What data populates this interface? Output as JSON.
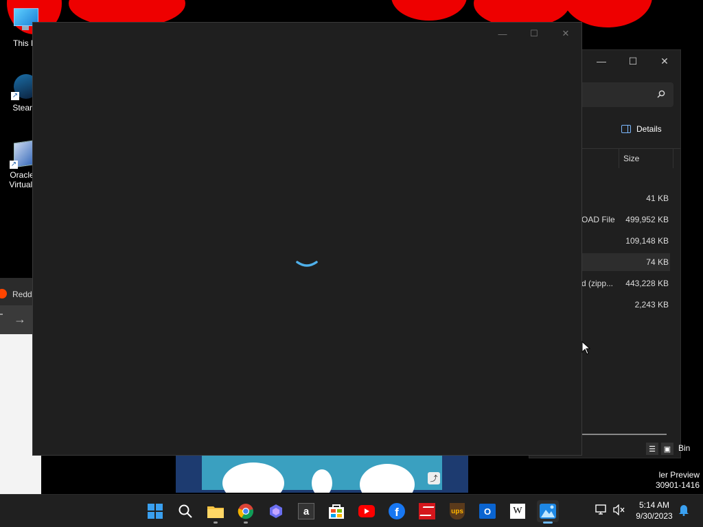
{
  "desktop": {
    "icons": [
      {
        "label": "This P",
        "icon": "monitor-icon"
      },
      {
        "label": "Stean",
        "icon": "steam-icon"
      },
      {
        "label": "Oracle",
        "label2": "VirtualI",
        "icon": "virtualbox-icon"
      }
    ],
    "watermark": {
      "line1": "ler Preview",
      "line2": "30901-1416"
    },
    "recycle_bin_label": "Bin"
  },
  "photos_window": {
    "controls": {
      "minimize": "—",
      "maximize": "☐",
      "close": "✕"
    },
    "state": "loading"
  },
  "explorer_window": {
    "controls": {
      "minimize": "—",
      "maximize": "☐",
      "close": "✕"
    },
    "search_icon": "search-icon",
    "details_label": "Details",
    "column_size": "Size",
    "rows": [
      {
        "type": "",
        "size": "41 KB"
      },
      {
        "type": "OAD File",
        "size": "499,952 KB"
      },
      {
        "type": "",
        "size": "109,148 KB"
      },
      {
        "type": "",
        "size": "74 KB",
        "selected": true
      },
      {
        "type": "d (zipp...",
        "size": "443,228 KB"
      },
      {
        "type": "",
        "size": "2,243 KB"
      }
    ]
  },
  "browser": {
    "tab_label": "Reddi",
    "forward_icon": "→"
  },
  "taskbar": {
    "apps": [
      {
        "name": "start",
        "icon": "windows-icon"
      },
      {
        "name": "search",
        "icon": "search-icon"
      },
      {
        "name": "file-explorer",
        "icon": "folder-icon",
        "running": true
      },
      {
        "name": "chrome",
        "icon": "chrome-icon",
        "running": true
      },
      {
        "name": "copilot",
        "icon": "copilot-icon"
      },
      {
        "name": "amazon",
        "icon": "amazon-icon"
      },
      {
        "name": "store",
        "icon": "store-icon"
      },
      {
        "name": "youtube",
        "icon": "youtube-icon"
      },
      {
        "name": "facebook",
        "icon": "facebook-icon"
      },
      {
        "name": "bank-of-america",
        "icon": "bank-icon"
      },
      {
        "name": "ups",
        "icon": "ups-icon"
      },
      {
        "name": "outlook",
        "icon": "outlook-icon"
      },
      {
        "name": "wikipedia",
        "icon": "wikipedia-icon"
      },
      {
        "name": "photos",
        "icon": "photos-icon",
        "active": true
      }
    ],
    "tray": {
      "network_icon": "network-icon",
      "volume_icon": "volume-muted-icon",
      "notification_icon": "bell-icon"
    },
    "clock": {
      "time": "5:14 AM",
      "date": "9/30/2023"
    }
  },
  "colors": {
    "accent": "#6cb8f6",
    "wallpaper_red": "#e00000",
    "window_bg": "#1f1f1f"
  }
}
